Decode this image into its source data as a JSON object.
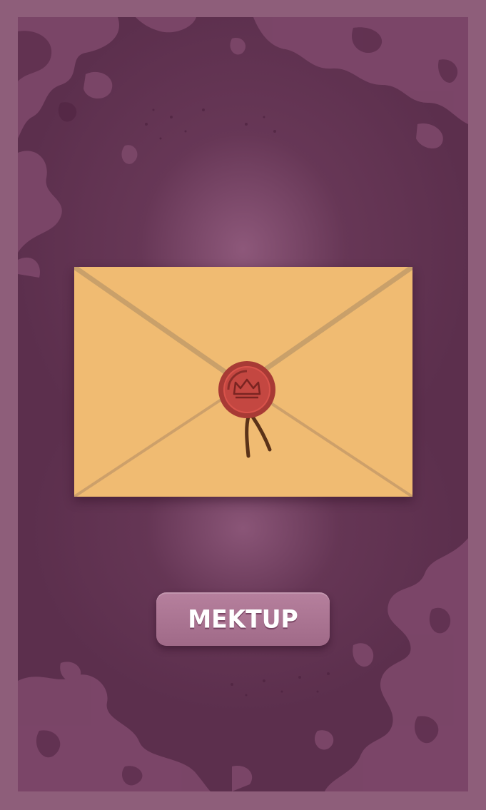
{
  "screen": {
    "name": "sealed-letter-screen",
    "frame_color": "#8e5e7a",
    "background_color": "#5c2f4d"
  },
  "envelope": {
    "paper_color": "#f0bb72",
    "fold_color": "#c9a06a",
    "seal": {
      "color": "#c94a43",
      "emblem": "crown-icon"
    }
  },
  "cta_button": {
    "label": "MEKTUP",
    "color": "#b07a97"
  }
}
